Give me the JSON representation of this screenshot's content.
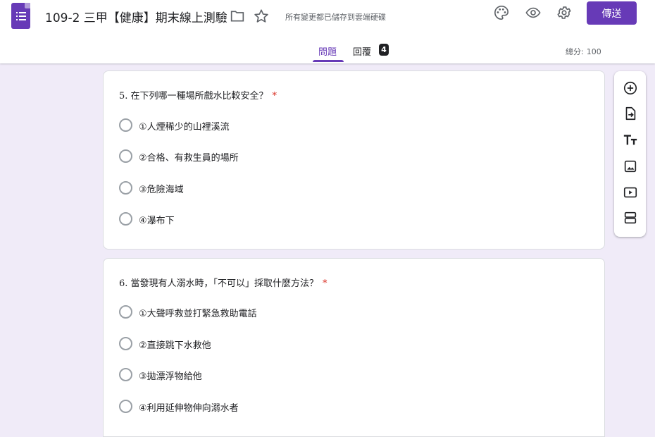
{
  "header": {
    "title": "109-2 三甲【健康】期末線上測驗",
    "saved_status": "所有變更都已儲存到雲端硬碟",
    "send_label": "傳送"
  },
  "tabs": {
    "questions_label": "問題",
    "responses_label": "回覆",
    "responses_count": "4"
  },
  "total_points": {
    "label": "總分:",
    "value": "100"
  },
  "questions": [
    {
      "title": "5. 在下列哪一種場所戲水比較安全？",
      "required_mark": "*",
      "options": [
        "①人煙稀少的山裡溪流",
        "②合格、有救生員的場所",
        "③危險海域",
        "④瀑布下"
      ]
    },
    {
      "title": "6. 當發現有人溺水時，「不可以」採取什麼方法？",
      "required_mark": "*",
      "options": [
        "①大聲呼救並打緊急救助電話",
        "②直接跳下水救他",
        "③拋漂浮物給他",
        "④利用延伸物伸向溺水者"
      ]
    }
  ],
  "icons": {
    "app": "google-forms-icon",
    "folder": "folder-icon",
    "star": "star-icon",
    "palette": "palette-icon",
    "preview": "eye-icon",
    "settings": "gear-icon",
    "toolbar": [
      "add-question-icon",
      "import-questions-icon",
      "add-title-icon",
      "add-image-icon",
      "add-video-icon",
      "add-section-icon"
    ]
  },
  "colors": {
    "accent": "#673ab7",
    "background": "#f0ebf8",
    "required": "#d93025"
  }
}
